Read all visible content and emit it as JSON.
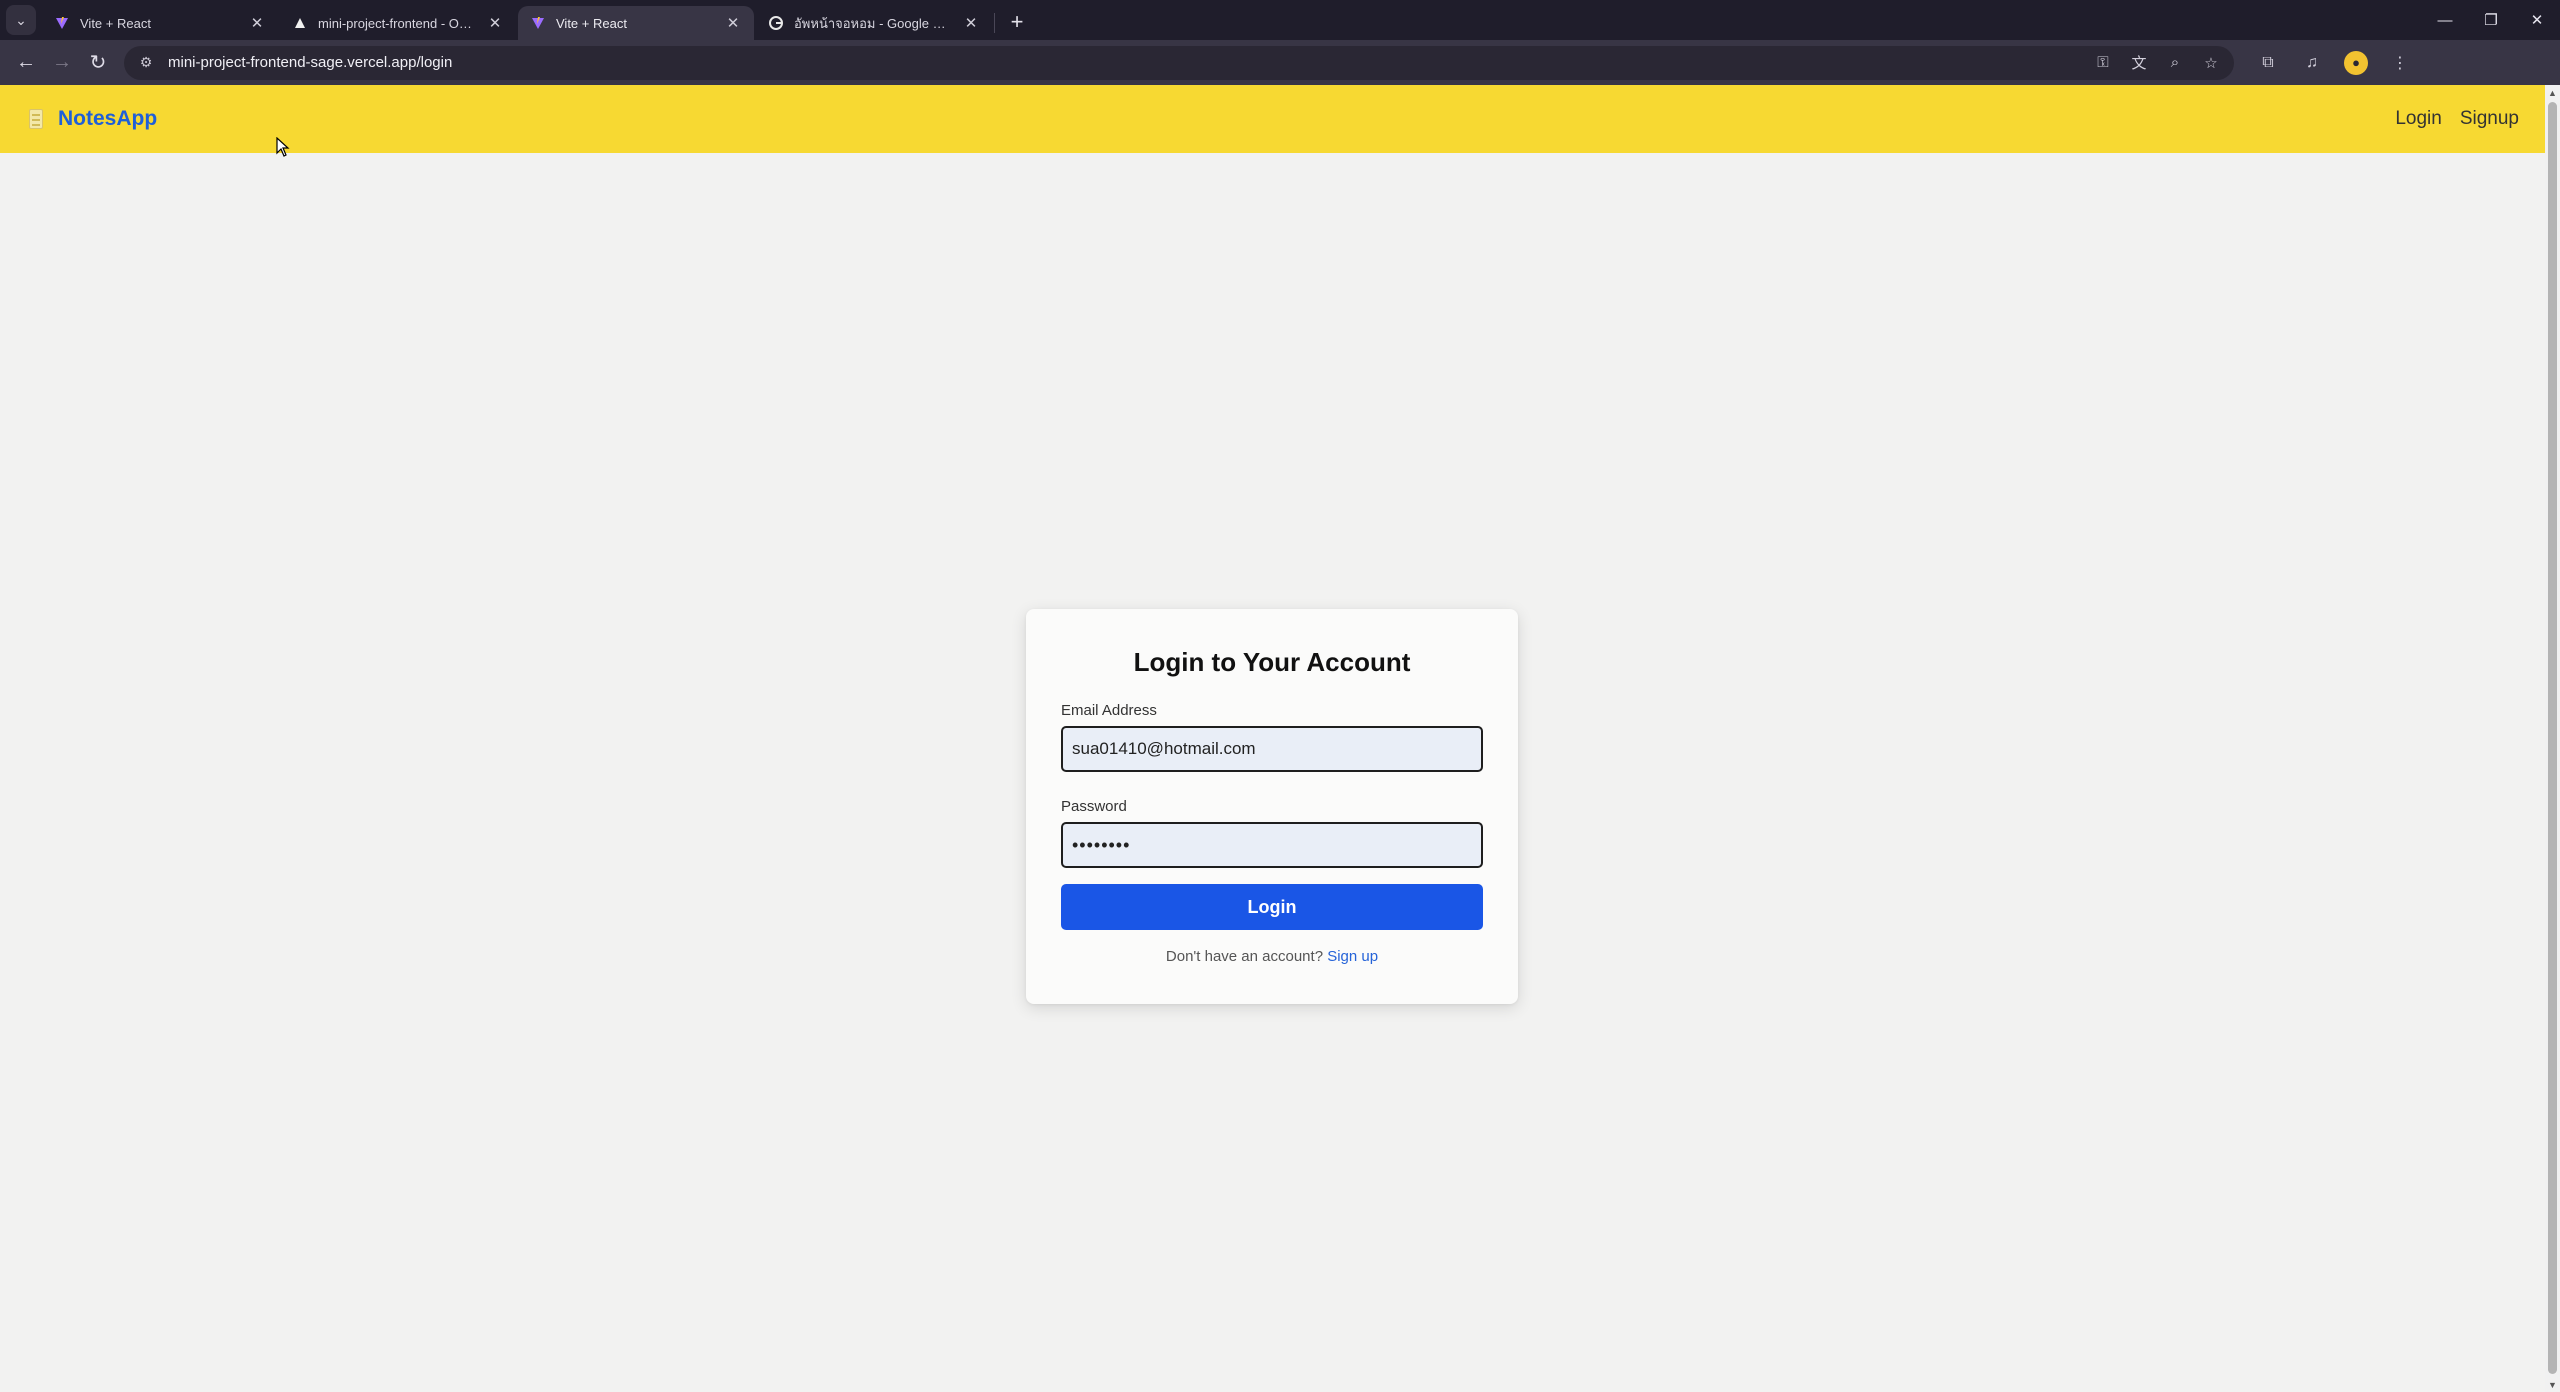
{
  "browser": {
    "tabs": [
      {
        "title": "Vite + React",
        "active": false,
        "favicon": "vite-icon"
      },
      {
        "title": "mini-project-frontend - Overview",
        "active": false,
        "favicon": "vercel-icon"
      },
      {
        "title": "Vite + React",
        "active": true,
        "favicon": "vite-icon"
      },
      {
        "title": "อัพหน้าจอหอม - Google Search",
        "active": false,
        "favicon": "google-icon"
      }
    ],
    "url": "mini-project-frontend-sage.vercel.app/login"
  },
  "navbar": {
    "brand": "NotesApp",
    "links": {
      "login": "Login",
      "signup": "Signup"
    }
  },
  "login_form": {
    "title": "Login to Your Account",
    "email_label": "Email Address",
    "email_value": "sua01410@hotmail.com",
    "password_label": "Password",
    "password_value": "••••••••",
    "submit_label": "Login",
    "signup_prompt": "Don't have an account?",
    "signup_link": "Sign up"
  },
  "colors": {
    "navbar_bg": "#f7d932",
    "brand": "#1f5fd8",
    "primary_button": "#1a56e6",
    "page_bg": "#f2f2f1"
  }
}
